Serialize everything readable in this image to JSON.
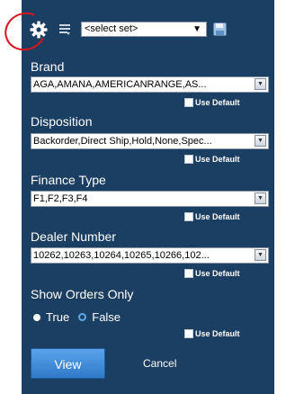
{
  "toolbar": {
    "gear_icon": "gear-icon",
    "list_icon": "list-icon",
    "set_select_value": "<select set>",
    "save_icon": "save-icon"
  },
  "form": {
    "brand_label": "Brand",
    "brand_value": "AGA,AMANA,AMERICANRANGE,AS...",
    "disposition_label": "Disposition",
    "disposition_value": "Backorder,Direct Ship,Hold,None,Spec...",
    "finance_type_label": "Finance Type",
    "finance_type_value": "F1,F2,F3,F4",
    "dealer_number_label": "Dealer Number",
    "dealer_number_value": "10262,10263,10264,10265,10266,102...",
    "use_default_label": "Use Default",
    "show_orders_label": "Show Orders Only",
    "radio_true_label": "True",
    "radio_false_label": "False",
    "selected_radio": "True"
  },
  "actions": {
    "view_label": "View",
    "cancel_label": "Cancel"
  },
  "colors": {
    "panel_bg": "#1b3e63",
    "highlight_circle": "#d8141c",
    "view_button": "#3f8bd8"
  }
}
